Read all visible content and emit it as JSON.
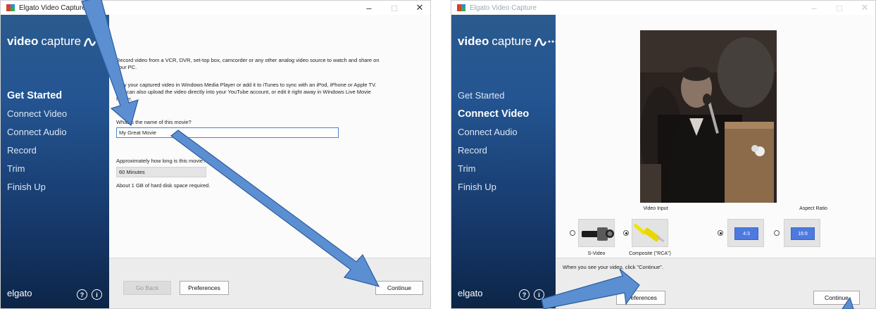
{
  "left_window": {
    "title": "Elgato Video Capture",
    "logo": {
      "bold": "video",
      "light": "capture"
    },
    "nav": [
      "Get Started",
      "Connect Video",
      "Connect Audio",
      "Record",
      "Trim",
      "Finish Up"
    ],
    "active_nav": "Get Started",
    "brand": "elgato",
    "intro_1": "Record video from a VCR, DVR, set-top box, camcorder or any other analog video source to watch and share on your PC.",
    "intro_2": "Play your captured video in Windows Media Player or add it to iTunes to sync with an iPod, iPhone or Apple TV. You can also upload the video directly into your YouTube account, or edit it right away in Windows Live Movie Maker.",
    "name_question": "What is the name of this movie?",
    "name_value": "My Great Movie",
    "length_question": "Approximately how long is this movie?",
    "length_value": "60 Minutes",
    "disk_note": "About 1 GB of hard disk space required.",
    "buttons": {
      "back": "Go Back",
      "preferences": "Preferences",
      "continue": "Continue"
    }
  },
  "right_window": {
    "title": "Elgato Video Capture",
    "logo": {
      "bold": "video",
      "light": "capture"
    },
    "nav": [
      "Get Started",
      "Connect Video",
      "Connect Audio",
      "Record",
      "Trim",
      "Finish Up"
    ],
    "active_nav": "Connect Video",
    "brand": "elgato",
    "video_input_label": "Video Input",
    "aspect_ratio_label": "Aspect Ratio",
    "inputs": [
      {
        "label": "S-Video",
        "selected": false
      },
      {
        "label": "Composite (\"RCA\")",
        "selected": true
      }
    ],
    "aspect_options": [
      {
        "label": "4:3",
        "selected": true
      },
      {
        "label": "16:9",
        "selected": false
      }
    ],
    "instruction": "When you see your video, click \"Continue\".",
    "buttons": {
      "preferences": "Preferences",
      "continue": "Continue"
    }
  },
  "window_controls": [
    "–",
    "□",
    "✕"
  ],
  "colors": {
    "sidebar": "#245592",
    "accent": "#4c7ae0",
    "annotation_arrow": "#5b8fd2",
    "focus": "#4a86c8"
  },
  "annotations": [
    "arrow to name field",
    "arrow to Continue button",
    "arrow to Preferences button",
    "arrow to Continue button"
  ]
}
